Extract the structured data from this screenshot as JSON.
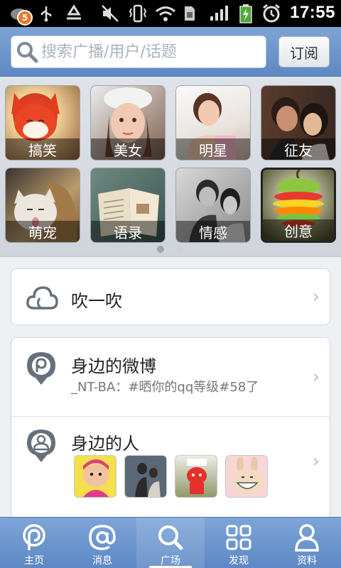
{
  "status_bar": {
    "notification_count": "5",
    "time": "17:55",
    "icons": [
      "app-notification-icon",
      "usb-icon",
      "recycle-icon",
      "mute-icon",
      "vibrate-icon",
      "wifi-icon",
      "sim-icon",
      "signal-icon",
      "battery-charging-icon",
      "alarm-icon"
    ]
  },
  "header": {
    "search_placeholder": "搜索广播/用户/话题",
    "subscribe_label": "订阅"
  },
  "categories": [
    {
      "label": "搞笑",
      "icon": "cartoon-fox-image"
    },
    {
      "label": "美女",
      "icon": "girl-portrait-image"
    },
    {
      "label": "明星",
      "icon": "star-portrait-image"
    },
    {
      "label": "征友",
      "icon": "couple-image"
    },
    {
      "label": "萌宠",
      "icon": "cat-image"
    },
    {
      "label": "语录",
      "icon": "open-book-image"
    },
    {
      "label": "情感",
      "icon": "couple-bw-image"
    },
    {
      "label": "创意",
      "icon": "apple-art-image"
    }
  ],
  "pager": {
    "pages": 2,
    "active": 0
  },
  "blow": {
    "title": "吹一吹",
    "icon": "cloud-icon"
  },
  "nearby_weibo": {
    "title": "身边的微博",
    "subtitle": "_NT-BA：#晒你的qq等级#58了",
    "icon": "location-weibo-icon"
  },
  "nearby_people": {
    "title": "身边的人",
    "icon": "person-location-icon",
    "avatars": [
      "cartoon-avatar",
      "couple-photo-avatar",
      "red-toy-avatar",
      "bunny-avatar"
    ]
  },
  "tabs": [
    {
      "label": "主页",
      "icon": "weibo-home-icon"
    },
    {
      "label": "消息",
      "icon": "at-icon"
    },
    {
      "label": "广场",
      "icon": "search-icon"
    },
    {
      "label": "发现",
      "icon": "grid-icon"
    },
    {
      "label": "资料",
      "icon": "profile-icon"
    }
  ],
  "active_tab": 2,
  "colors": {
    "header": "#6f97cc",
    "tabbar": "#6b94cd",
    "accent_badge": "#e8782a"
  }
}
